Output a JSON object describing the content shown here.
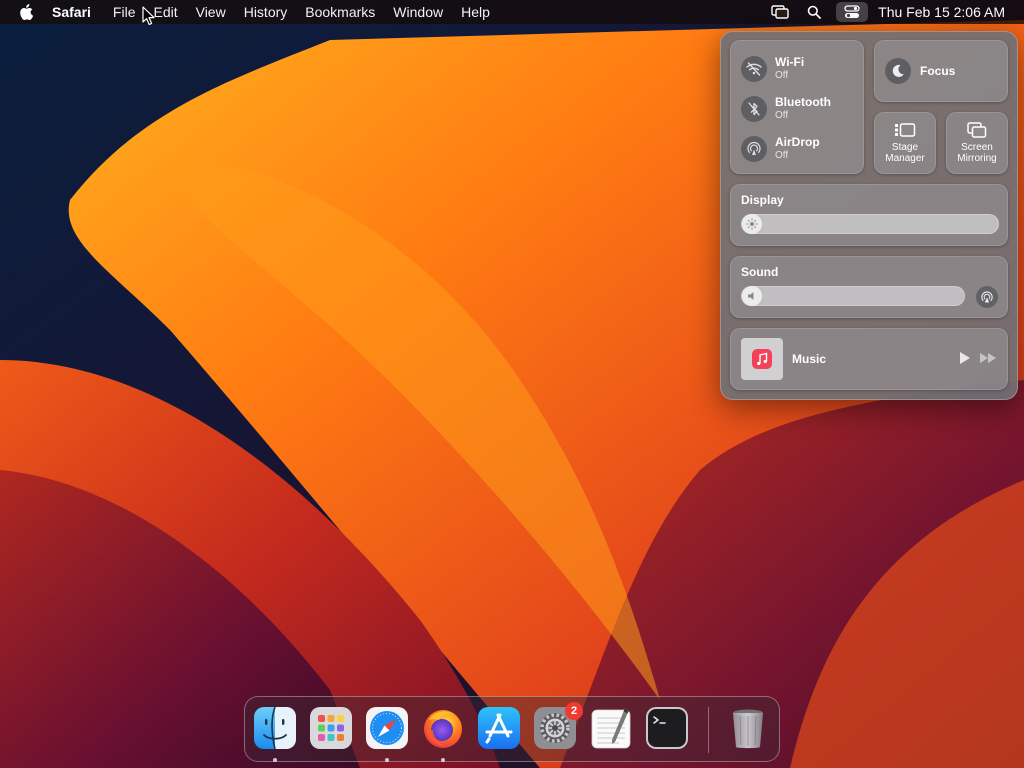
{
  "menubar": {
    "app_name": "Safari",
    "menus": [
      "File",
      "Edit",
      "View",
      "History",
      "Bookmarks",
      "Window",
      "Help"
    ],
    "status_icons": [
      "screen-mirroring-icon",
      "search-icon",
      "control-center-icon"
    ],
    "clock": "Thu Feb 15  2:06 AM"
  },
  "control_center": {
    "wifi": {
      "title": "Wi-Fi",
      "status": "Off"
    },
    "bluetooth": {
      "title": "Bluetooth",
      "status": "Off"
    },
    "airdrop": {
      "title": "AirDrop",
      "status": "Off"
    },
    "focus": {
      "label": "Focus"
    },
    "stage_manager": {
      "label_line1": "Stage",
      "label_line2": "Manager"
    },
    "screen_mirroring": {
      "label_line1": "Screen",
      "label_line2": "Mirroring"
    },
    "display": {
      "title": "Display",
      "level": 0.0
    },
    "sound": {
      "title": "Sound",
      "level": 0.0
    },
    "music": {
      "title": "Music"
    }
  },
  "dock": {
    "apps": [
      {
        "name": "Finder",
        "icon": "finder-icon",
        "running": true
      },
      {
        "name": "Launchpad",
        "icon": "launchpad-icon",
        "running": false
      },
      {
        "name": "Safari",
        "icon": "safari-icon",
        "running": true
      },
      {
        "name": "Firefox",
        "icon": "firefox-icon",
        "running": true
      },
      {
        "name": "App Store",
        "icon": "app-store-icon",
        "running": false
      },
      {
        "name": "System Settings",
        "icon": "system-settings-icon",
        "running": false,
        "badge": "2"
      },
      {
        "name": "TextEdit",
        "icon": "textedit-icon",
        "running": false
      },
      {
        "name": "Terminal",
        "icon": "terminal-icon",
        "running": false
      }
    ],
    "trash": {
      "name": "Trash",
      "icon": "trash-icon"
    }
  },
  "colors": {
    "accent_badge": "#f03a30",
    "wallpaper_orange": "#ff7a12",
    "wallpaper_red": "#d8321c",
    "wallpaper_navy": "#0a1730"
  }
}
